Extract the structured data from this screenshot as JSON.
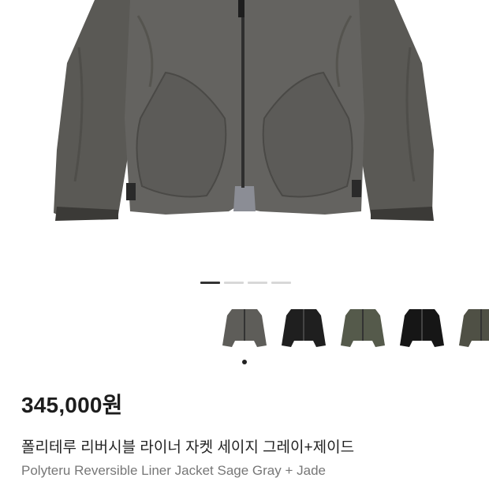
{
  "product": {
    "image_alt": "Gray reversible liner jacket",
    "price": "345,000원",
    "title_ko": "폴리테루 리버시블 라이너 자켓 세이지 그레이+제이드",
    "title_en": "Polyteru Reversible Liner Jacket Sage Gray + Jade"
  },
  "pager": {
    "total": 4,
    "active_index": 0
  },
  "thumbnails": [
    {
      "name": "gray-jacket",
      "color": "#5e5d59"
    },
    {
      "name": "black-jacket",
      "color": "#1f1f1f"
    },
    {
      "name": "sage-jacket",
      "color": "#555a4b"
    },
    {
      "name": "black-jacket-2",
      "color": "#161616"
    },
    {
      "name": "olive-jacket",
      "color": "#4f5045"
    }
  ],
  "colors": {
    "jacket_main": "#5f5e5a",
    "jacket_shadow": "#4a4946",
    "lining": "#8b8d95"
  }
}
